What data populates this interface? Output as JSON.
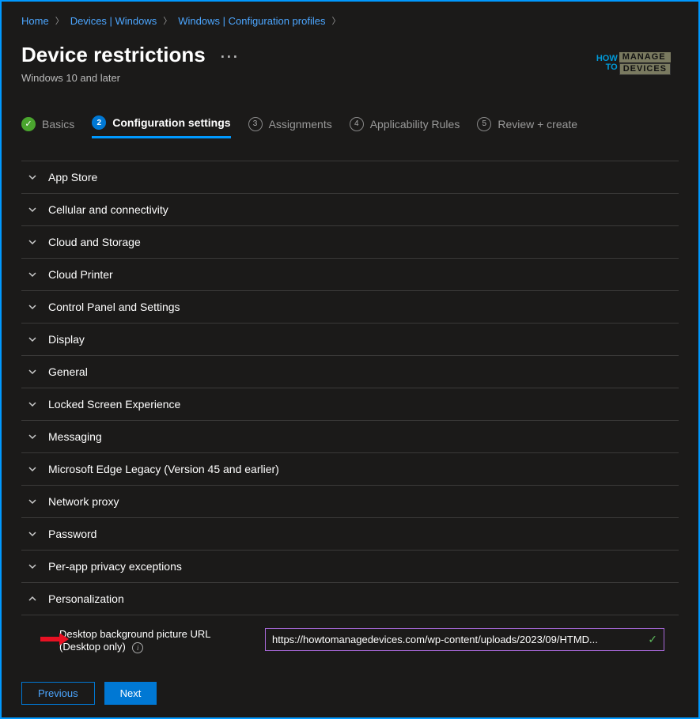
{
  "breadcrumb": [
    {
      "label": "Home"
    },
    {
      "label": "Devices | Windows"
    },
    {
      "label": "Windows | Configuration profiles"
    }
  ],
  "header": {
    "title": "Device restrictions",
    "subtitle": "Windows 10 and later",
    "more": "···"
  },
  "logo": {
    "how": "HOW",
    "to": "TO",
    "manage": "MANAGE",
    "devices": "DEVICES"
  },
  "tabs": [
    {
      "num": "✓",
      "label": "Basics",
      "state": "done"
    },
    {
      "num": "2",
      "label": "Configuration settings",
      "state": "active"
    },
    {
      "num": "3",
      "label": "Assignments",
      "state": ""
    },
    {
      "num": "4",
      "label": "Applicability Rules",
      "state": ""
    },
    {
      "num": "5",
      "label": "Review + create",
      "state": ""
    }
  ],
  "accordion": [
    {
      "label": "App Store",
      "expanded": false
    },
    {
      "label": "Cellular and connectivity",
      "expanded": false
    },
    {
      "label": "Cloud and Storage",
      "expanded": false
    },
    {
      "label": "Cloud Printer",
      "expanded": false
    },
    {
      "label": "Control Panel and Settings",
      "expanded": false
    },
    {
      "label": "Display",
      "expanded": false
    },
    {
      "label": "General",
      "expanded": false
    },
    {
      "label": "Locked Screen Experience",
      "expanded": false
    },
    {
      "label": "Messaging",
      "expanded": false
    },
    {
      "label": "Microsoft Edge Legacy (Version 45 and earlier)",
      "expanded": false
    },
    {
      "label": "Network proxy",
      "expanded": false
    },
    {
      "label": "Password",
      "expanded": false
    },
    {
      "label": "Per-app privacy exceptions",
      "expanded": false
    },
    {
      "label": "Personalization",
      "expanded": true
    }
  ],
  "setting": {
    "label": "Desktop background picture URL",
    "sublabel": "(Desktop only)",
    "value": "https://howtomanagedevices.com/wp-content/uploads/2023/09/HTMD..."
  },
  "footer": {
    "previous": "Previous",
    "next": "Next"
  }
}
